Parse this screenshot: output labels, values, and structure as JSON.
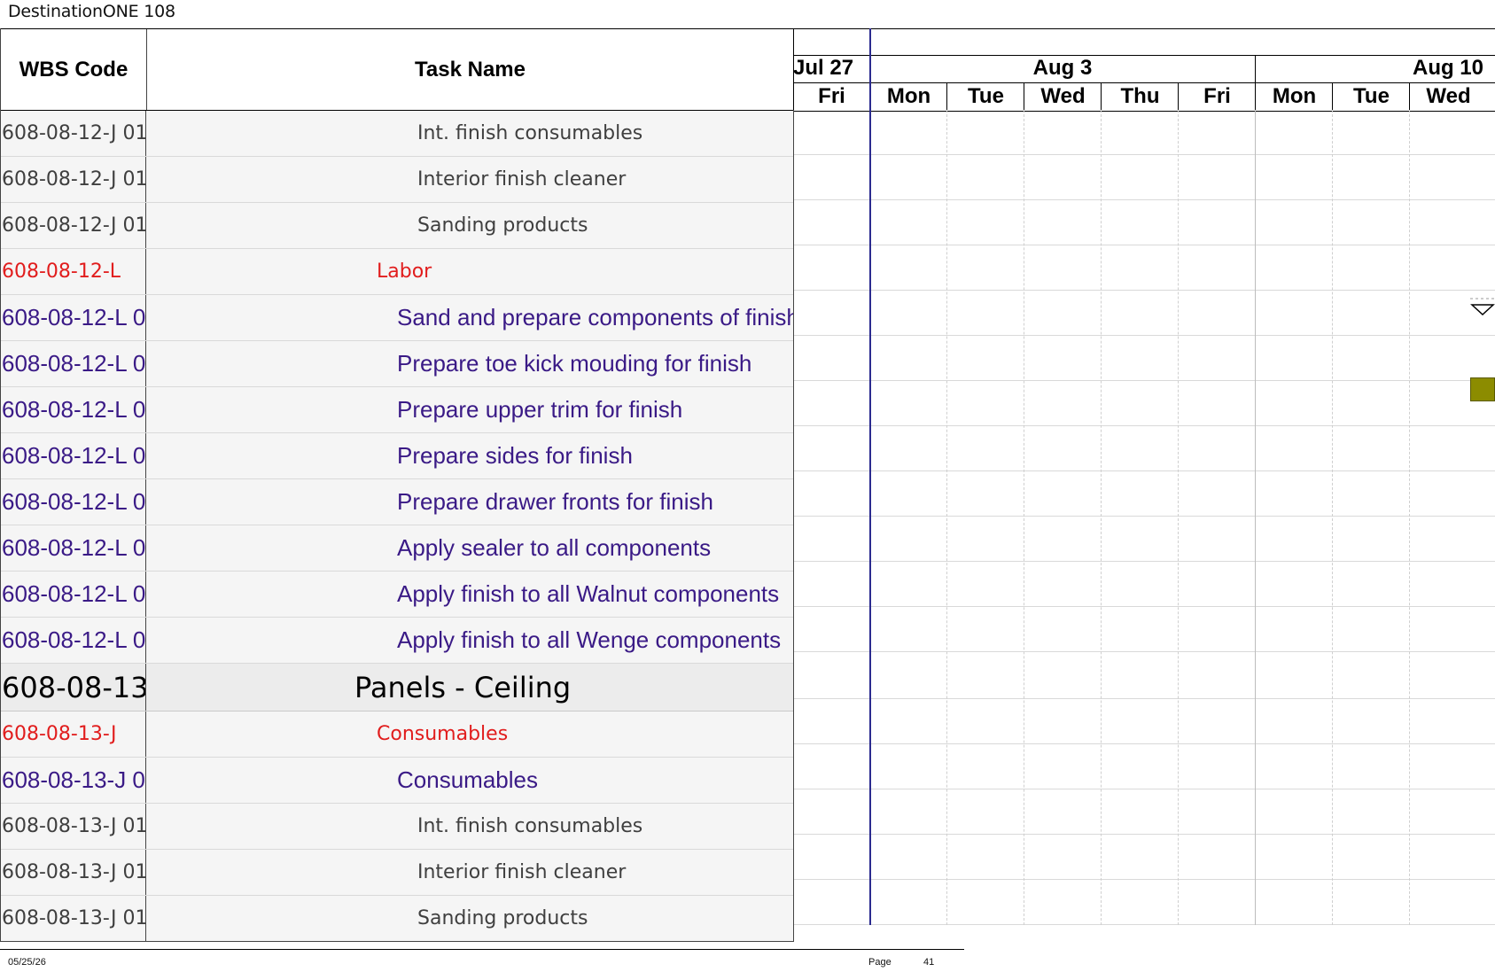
{
  "doc_title": "DestinationONE 108",
  "columns": {
    "wbs": "WBS Code",
    "task": "Task Name"
  },
  "timeline": {
    "weeks": [
      "Jul 27",
      "Aug 3",
      "Aug 10"
    ],
    "days": [
      "Fri",
      "Mon",
      "Tue",
      "Wed",
      "Thu",
      "Fri",
      "Mon",
      "Tue",
      "Wed"
    ]
  },
  "rows": [
    {
      "wbs": "608-08-12-J 01",
      "name": "Int. finish consumables",
      "style": "item"
    },
    {
      "wbs": "608-08-12-J 01",
      "name": "Interior finish cleaner",
      "style": "item"
    },
    {
      "wbs": "608-08-12-J 01",
      "name": "Sanding products",
      "style": "item"
    },
    {
      "wbs": "608-08-12-L",
      "name": "Labor",
      "style": "red"
    },
    {
      "wbs": "608-08-12-L 0",
      "name": "Sand and prepare components of finish",
      "style": "task"
    },
    {
      "wbs": "608-08-12-L 0",
      "name": "Prepare toe kick mouding for finish",
      "style": "task"
    },
    {
      "wbs": "608-08-12-L 0",
      "name": "Prepare upper trim for finish",
      "style": "task"
    },
    {
      "wbs": "608-08-12-L 0",
      "name": "Prepare sides for finish",
      "style": "task"
    },
    {
      "wbs": "608-08-12-L 0",
      "name": "Prepare drawer fronts for finish",
      "style": "task"
    },
    {
      "wbs": "608-08-12-L 0",
      "name": "Apply sealer to all components",
      "style": "task"
    },
    {
      "wbs": "608-08-12-L 0",
      "name": "Apply finish to all Walnut components",
      "style": "task"
    },
    {
      "wbs": "608-08-12-L 0",
      "name": "Apply finish to all Wenge components",
      "style": "task"
    },
    {
      "wbs": "608-08-13",
      "name": "Panels - Ceiling",
      "style": "big"
    },
    {
      "wbs": "608-08-13-J",
      "name": "Consumables",
      "style": "red"
    },
    {
      "wbs": "608-08-13-J 0",
      "name": "Consumables",
      "style": "task"
    },
    {
      "wbs": "608-08-13-J 01",
      "name": "Int. finish consumables",
      "style": "item"
    },
    {
      "wbs": "608-08-13-J 01",
      "name": "Interior finish cleaner",
      "style": "item"
    },
    {
      "wbs": "608-08-13-J 01",
      "name": "Sanding products",
      "style": "item"
    }
  ],
  "footer": {
    "date": "05/25/26",
    "page_label": "Page",
    "page_number": "41"
  },
  "colors": {
    "item_text": "#3f3f3f",
    "summary_text": "#e11d1d",
    "task_text": "#3a1a86",
    "task_bar": "#8c8c00",
    "today_line": "#2b2b8f"
  }
}
